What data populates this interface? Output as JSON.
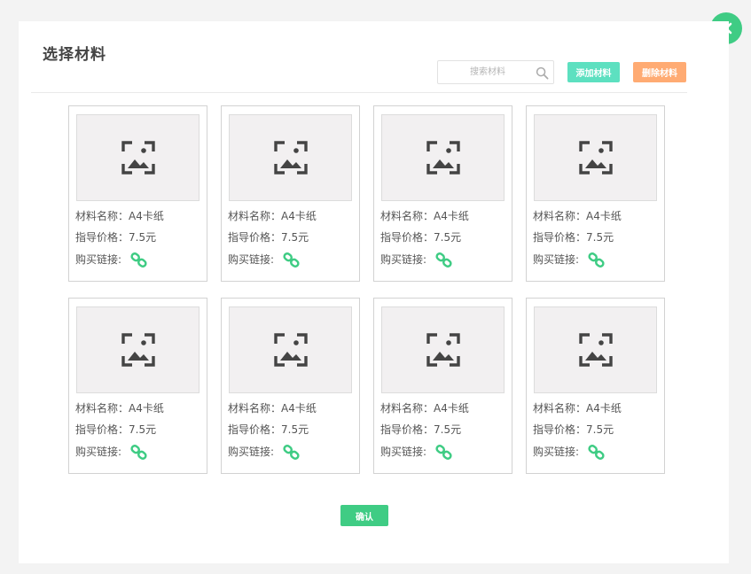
{
  "dialog": {
    "title": "选择材料",
    "search_placeholder": "搜索材料",
    "add_label": "添加材料",
    "delete_label": "删除材料",
    "confirm_label": "确认"
  },
  "colors": {
    "accent_green": "#3fcc84",
    "add_button": "#5de0c0",
    "delete_button": "#ffab73",
    "link_icon": "#3fcc84"
  },
  "materials": [
    {
      "name_line": "材料名称：A4卡纸",
      "price_line": "指导价格：7.5元",
      "link_label": "购买链接:"
    },
    {
      "name_line": "材料名称：A4卡纸",
      "price_line": "指导价格：7.5元",
      "link_label": "购买链接:"
    },
    {
      "name_line": "材料名称：A4卡纸",
      "price_line": "指导价格：7.5元",
      "link_label": "购买链接:"
    },
    {
      "name_line": "材料名称：A4卡纸",
      "price_line": "指导价格：7.5元",
      "link_label": "购买链接:"
    },
    {
      "name_line": "材料名称：A4卡纸",
      "price_line": "指导价格：7.5元",
      "link_label": "购买链接:"
    },
    {
      "name_line": "材料名称：A4卡纸",
      "price_line": "指导价格：7.5元",
      "link_label": "购买链接:"
    },
    {
      "name_line": "材料名称：A4卡纸",
      "price_line": "指导价格：7.5元",
      "link_label": "购买链接:"
    },
    {
      "name_line": "材料名称：A4卡纸",
      "price_line": "指导价格：7.5元",
      "link_label": "购买链接:"
    }
  ],
  "icons": {
    "close": "close-icon",
    "search": "search-icon",
    "thumbnail": "image-placeholder-icon",
    "buy_link": "link-icon"
  }
}
